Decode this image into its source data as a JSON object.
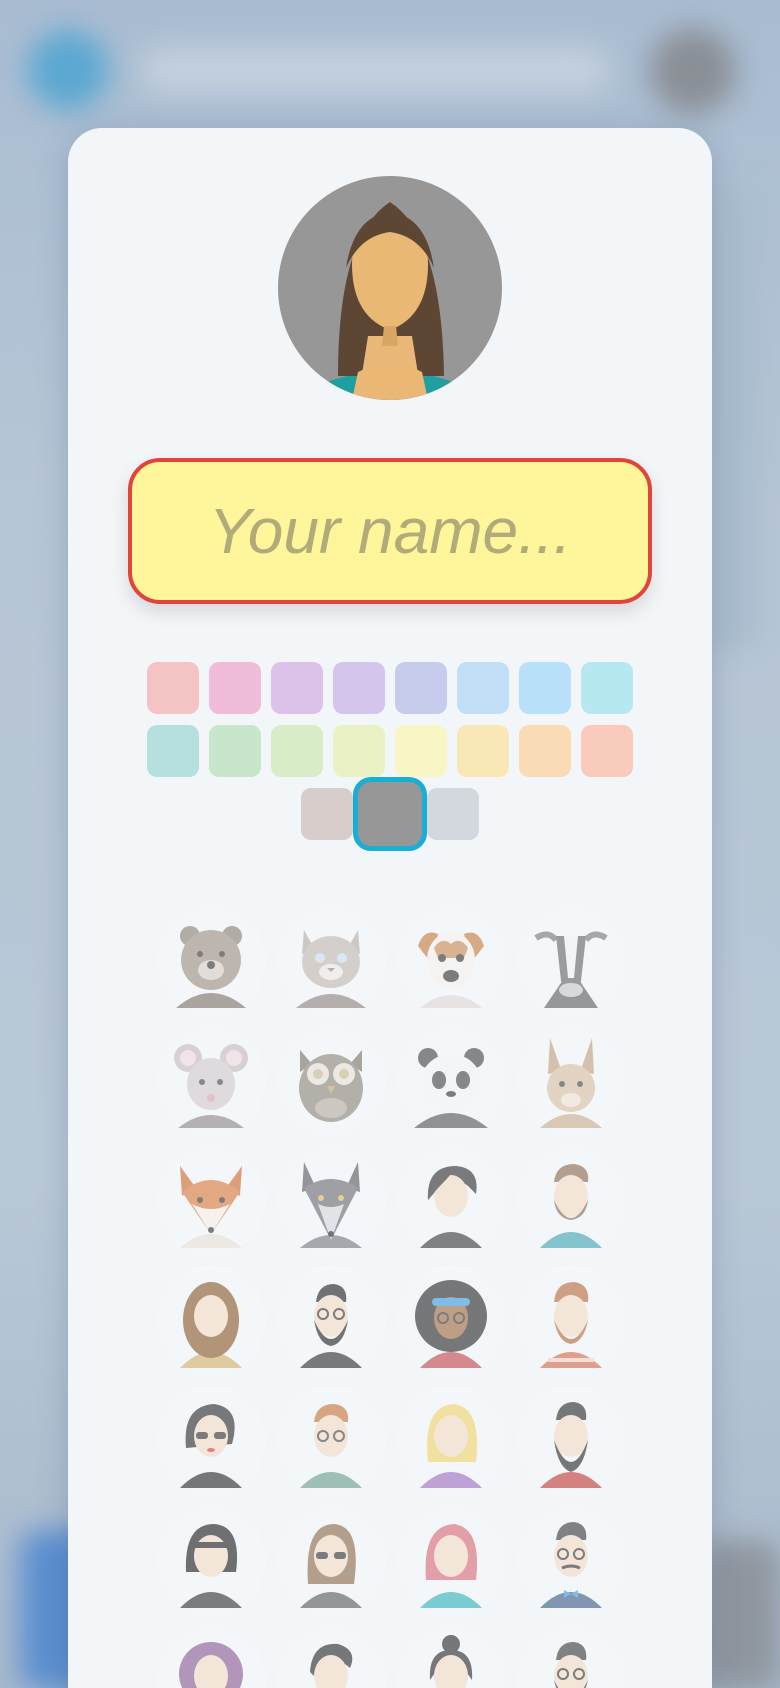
{
  "name_input": {
    "placeholder": "Your name..."
  },
  "colors": {
    "input_border": "#e0443a",
    "input_fill": "#fff69b",
    "selected_outline": "#19aed3",
    "avatar_preview_bg": "#979797"
  },
  "preview_avatar": {
    "icon": "woman-long-brown-hair-icon"
  },
  "swatches": {
    "rows": [
      [
        "#f4c4c4",
        "#f1bcd9",
        "#dcc1e9",
        "#d3c5ec",
        "#c7cced",
        "#c2dff8",
        "#b8e1f9",
        "#b6e8ef"
      ],
      [
        "#b5e0df",
        "#c7e6cb",
        "#d9ecc8",
        "#eaf2c5",
        "#f8f6c5",
        "#f9e8b6",
        "#f9dbb5",
        "#f8cbbd"
      ],
      [
        "#d7cdcb",
        "#979797",
        "#d3d8de"
      ]
    ],
    "selected": "#979797"
  },
  "avatars": [
    {
      "name": "bear"
    },
    {
      "name": "cat"
    },
    {
      "name": "dog"
    },
    {
      "name": "cow"
    },
    {
      "name": "mouse"
    },
    {
      "name": "owl"
    },
    {
      "name": "panda"
    },
    {
      "name": "rabbit"
    },
    {
      "name": "fox"
    },
    {
      "name": "wolf"
    },
    {
      "name": "woman-short-hair"
    },
    {
      "name": "man-beard-teal-shirt"
    },
    {
      "name": "woman-curly-long-hair"
    },
    {
      "name": "man-beard-glasses-suit"
    },
    {
      "name": "woman-afro-headband"
    },
    {
      "name": "man-red-beard-striped-shirt"
    },
    {
      "name": "woman-sunglasses-red-lips"
    },
    {
      "name": "man-glasses-ginger"
    },
    {
      "name": "woman-blonde"
    },
    {
      "name": "man-long-beard-red-jacket"
    },
    {
      "name": "woman-bob-black-hair"
    },
    {
      "name": "man-long-hair-sunglasses"
    },
    {
      "name": "woman-pink-hair"
    },
    {
      "name": "man-glasses-bowtie"
    },
    {
      "name": "woman-curly-purple-hair"
    },
    {
      "name": "man-side-hair"
    },
    {
      "name": "woman-bun"
    },
    {
      "name": "man-glasses-beard"
    }
  ]
}
